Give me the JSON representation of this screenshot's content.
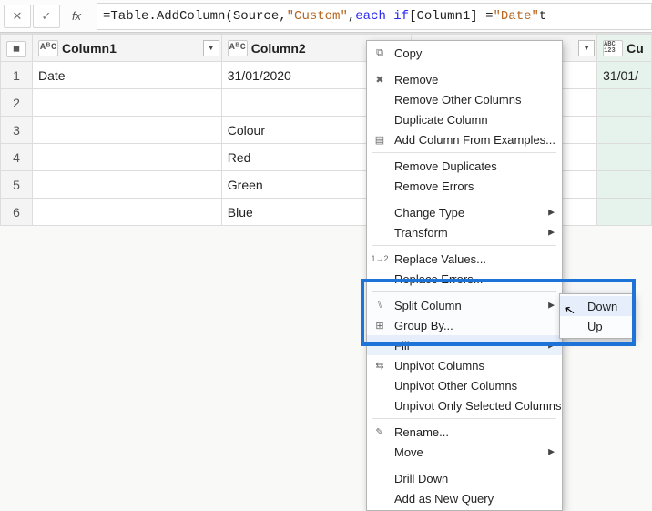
{
  "formula": {
    "eq": "=",
    "p1": " Table.AddColumn(Source, ",
    "s1": "\"Custom\"",
    "p2": ", ",
    "kw": "each if",
    "p3": " [Column1] = ",
    "s2": "\"Date\"",
    "p4": " t"
  },
  "columns": {
    "c1": {
      "type": "AᴮC",
      "label": "Column1"
    },
    "c2": {
      "type": "AᴮC",
      "label": "Column2"
    },
    "c3": {
      "type": "ABC\n123",
      "label": "Cu"
    }
  },
  "rows": {
    "r1": {
      "n": "1",
      "c1": "Date",
      "c2": "31/01/2020",
      "c3": "31/01/"
    },
    "r2": {
      "n": "2",
      "c1": "",
      "c2": "",
      "c3": ""
    },
    "r3": {
      "n": "3",
      "c1": "",
      "c2": "Colour",
      "c3": ""
    },
    "r4": {
      "n": "4",
      "c1": "",
      "c2": "Red",
      "c3": ""
    },
    "r5": {
      "n": "5",
      "c1": "",
      "c2": "Green",
      "c3": ""
    },
    "r6": {
      "n": "6",
      "c1": "",
      "c2": "Blue",
      "c3": ""
    }
  },
  "menu": {
    "copy": "Copy",
    "remove": "Remove",
    "removeOther": "Remove Other Columns",
    "duplicate": "Duplicate Column",
    "addFromExamples": "Add Column From Examples...",
    "removeDup": "Remove Duplicates",
    "removeErr": "Remove Errors",
    "changeType": "Change Type",
    "transform": "Transform",
    "replaceVal": "Replace Values...",
    "replaceErr": "Replace Errors...",
    "split": "Split Column",
    "groupBy": "Group By...",
    "fill": "Fill",
    "unpivot": "Unpivot Columns",
    "unpivotOther": "Unpivot Other Columns",
    "unpivotSel": "Unpivot Only Selected Columns",
    "rename": "Rename...",
    "move": "Move",
    "drill": "Drill Down",
    "addNew": "Add as New Query"
  },
  "submenu": {
    "down": "Down",
    "up": "Up"
  }
}
